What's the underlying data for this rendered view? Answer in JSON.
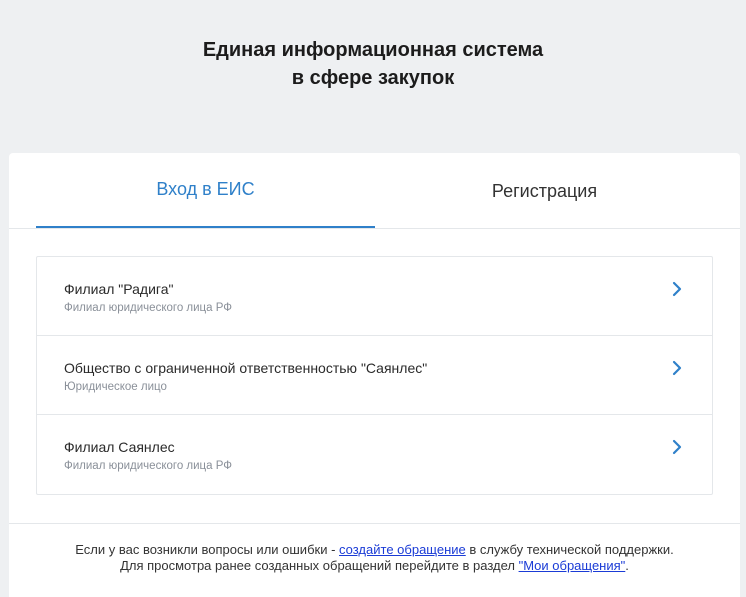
{
  "header": {
    "title_line1": "Единая информационная система",
    "title_line2": "в сфере закупок"
  },
  "tabs": [
    {
      "label": "Вход в ЕИС",
      "active": true
    },
    {
      "label": "Регистрация",
      "active": false
    }
  ],
  "organizations": [
    {
      "name": "Филиал \"Радига\"",
      "type": "Филиал юридического лица РФ"
    },
    {
      "name": "Общество с ограниченной ответственностью \"Саянлес\"",
      "type": "Юридическое лицо"
    },
    {
      "name": "Филиал Саянлес",
      "type": "Филиал юридического лица РФ"
    }
  ],
  "footer": {
    "line1_prefix": "Если у вас возникли вопросы или ошибки - ",
    "line1_link": "создайте обращение",
    "line1_suffix": " в службу технической поддержки.",
    "line2_prefix": "Для просмотра ранее созданных обращений перейдите в раздел ",
    "line2_link": "\"Мои обращения\"",
    "line2_suffix": "."
  },
  "colors": {
    "accent": "#2f80c9",
    "link": "#1a3bd6",
    "background": "#eef0f2"
  },
  "icons": {
    "chevron": "chevron-right-icon"
  }
}
